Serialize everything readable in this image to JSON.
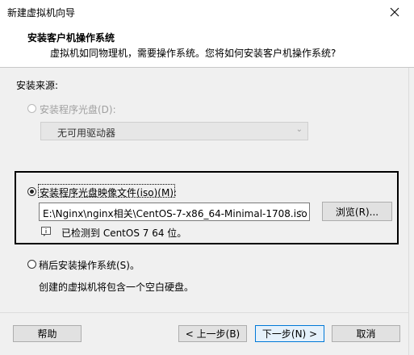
{
  "window": {
    "title": "新建虚拟机向导",
    "close_icon": "close-icon"
  },
  "header": {
    "title": "安装客户机操作系统",
    "subtitle": "虚拟机如同物理机，需要操作系统。您将如何安装客户机操作系统?"
  },
  "source": {
    "label": "安装来源:",
    "disc_option": {
      "label": "安装程序光盘(D):",
      "selected": false,
      "enabled": false,
      "drive_select_value": "无可用驱动器"
    },
    "iso_option": {
      "label": "安装程序光盘映像文件(iso)(M):",
      "selected": true,
      "path_value": "E:\\Nginx\\nginx相关\\CentOS-7-x86_64-Minimal-1708.iso",
      "browse_label": "浏览(R)...",
      "detected_text": "已检测到 CentOS 7 64 位。",
      "info_icon": "info-icon"
    },
    "later_option": {
      "label": "稍后安装操作系统(S)。",
      "selected": false,
      "description": "创建的虚拟机将包含一个空白硬盘。"
    }
  },
  "footer": {
    "help": "帮助",
    "back": "< 上一步(B)",
    "next": "下一步(N) >",
    "cancel": "取消"
  },
  "colors": {
    "body_bg": "#f0f0f0",
    "focus_border": "#0078d7",
    "disabled_text": "#a0a0a0"
  }
}
